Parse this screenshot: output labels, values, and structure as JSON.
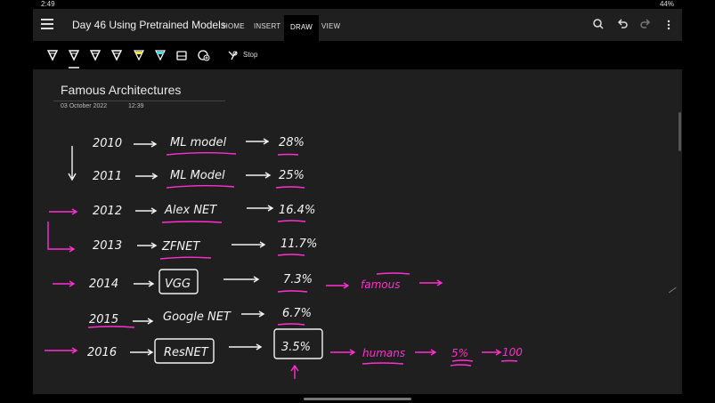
{
  "status": {
    "time": "2:49",
    "battery": "44%"
  },
  "app": {
    "title": "Day 46 Using Pretrained Models",
    "tabs": [
      {
        "label": "HOME"
      },
      {
        "label": "INSERT"
      },
      {
        "label": "DRAW",
        "active": true
      },
      {
        "label": "VIEW"
      }
    ],
    "icons": [
      "menu-icon",
      "search-icon",
      "undo-icon",
      "redo-icon",
      "more-icon"
    ]
  },
  "toolbar": {
    "pens": [
      {
        "name": "pen-white",
        "color": "#ffffff"
      },
      {
        "name": "pen-white-selected",
        "color": "#ffffff"
      },
      {
        "name": "pen-white-2",
        "color": "#ffffff"
      },
      {
        "name": "pen-white-3",
        "color": "#ffffff"
      },
      {
        "name": "highlighter-yellow",
        "color": "#f0e640"
      },
      {
        "name": "highlighter-cyan",
        "color": "#4ee0e0"
      },
      {
        "name": "eraser",
        "color": "#ffffff"
      },
      {
        "name": "shapes",
        "color": "#ffffff"
      }
    ],
    "stop_label": "Stop"
  },
  "note": {
    "title": "Famous Architectures",
    "date": "03 October 2022",
    "time": "12:39"
  },
  "handwriting": {
    "years": [
      "2010",
      "2011",
      "2012",
      "2013",
      "2014",
      "2015",
      "2016"
    ],
    "models": [
      "ML model",
      "ML Model",
      "Alex NET",
      "ZFNET",
      "VGG",
      "Google NET",
      "ResNET"
    ],
    "error_rates": [
      "28%",
      "25%",
      "16.4%",
      "11.7%",
      "7.3%",
      "6.7%",
      "3.5%"
    ],
    "extras": [
      "famous",
      "humans",
      "5%",
      "100"
    ]
  },
  "colors": {
    "ink_white": "#f4f4f4",
    "ink_pink": "#ff2fcf",
    "background": "#1f1f1f"
  }
}
